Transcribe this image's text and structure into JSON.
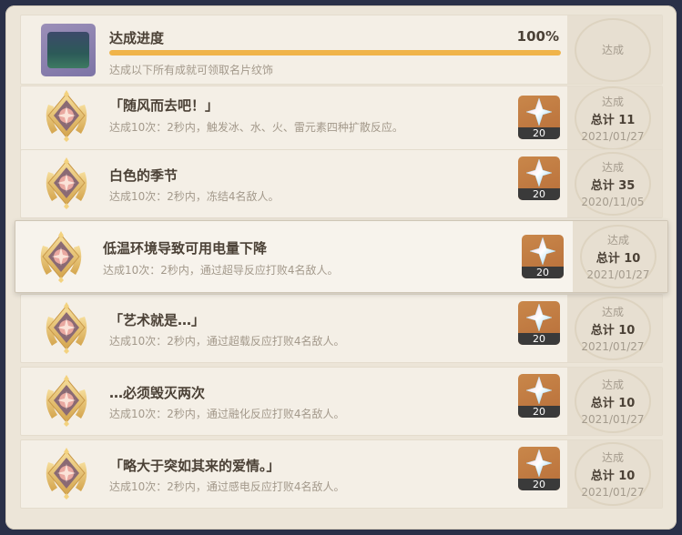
{
  "progress": {
    "title": "达成进度",
    "percent_label": "100%",
    "percent_value": 100,
    "description": "达成以下所有成就可领取名片纹饰",
    "stamp_label": "达成"
  },
  "achievements": [
    {
      "title": "「随风而去吧！」",
      "description": "达成10次：2秒内，触发冰、水、火、雷元素四种扩散反应。",
      "reward_qty": "20",
      "status": "达成",
      "total": "总计 11",
      "date": "2021/01/27"
    },
    {
      "title": "白色的季节",
      "description": "达成10次：2秒内，冻结4名敌人。",
      "reward_qty": "20",
      "status": "达成",
      "total": "总计 35",
      "date": "2020/11/05"
    },
    {
      "title": "低温环境导致可用电量下降",
      "description": "达成10次：2秒内，通过超导反应打败4名敌人。",
      "reward_qty": "20",
      "status": "达成",
      "total": "总计 10",
      "date": "2021/01/27"
    },
    {
      "title": "「艺术就是…」",
      "description": "达成10次：2秒内，通过超载反应打败4名敌人。",
      "reward_qty": "20",
      "status": "达成",
      "total": "总计 10",
      "date": "2021/01/27"
    },
    {
      "title": "…必须毁灭两次",
      "description": "达成10次：2秒内，通过融化反应打败4名敌人。",
      "reward_qty": "20",
      "status": "达成",
      "total": "总计 10",
      "date": "2021/01/27"
    },
    {
      "title": "「略大于突如其来的爱情。」",
      "description": "达成10次：2秒内，通过感电反应打败4名敌人。",
      "reward_qty": "20",
      "status": "达成",
      "total": "总计 10",
      "date": "2021/01/27"
    }
  ],
  "colors": {
    "panel_bg": "#ece5d8",
    "progress_fill": "#f0b44a",
    "title_text": "#4b4136",
    "muted_text": "#a3998b",
    "reward_bg": "#c9874a"
  }
}
